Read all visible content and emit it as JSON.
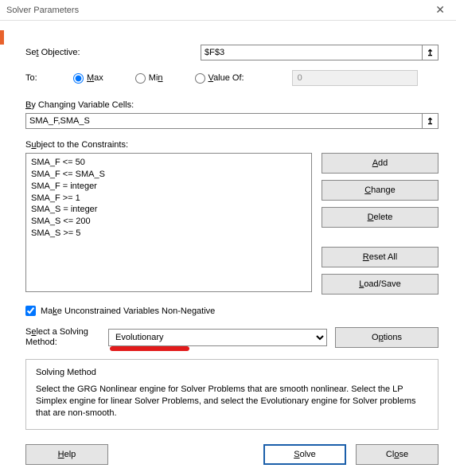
{
  "window": {
    "title": "Solver Parameters"
  },
  "objective": {
    "label_pre": "Se",
    "label_u": "t",
    "label_post": " Objective:",
    "value": "$F$3"
  },
  "to": {
    "label": "To:",
    "max_u": "M",
    "max_post": "ax",
    "min_pre": "Mi",
    "min_u": "n",
    "valueof_u": "V",
    "valueof_post": "alue Of:",
    "valueof_value": "0"
  },
  "cells": {
    "label_u": "B",
    "label_post": "y Changing Variable Cells:",
    "value": "SMA_F,SMA_S"
  },
  "constraints": {
    "label_pre": "S",
    "label_u": "u",
    "label_post": "bject to the Constraints:",
    "items": [
      "SMA_F <= 50",
      "SMA_F <= SMA_S",
      "SMA_F = integer",
      "SMA_F >= 1",
      "SMA_S = integer",
      "SMA_S <= 200",
      "SMA_S >= 5"
    ],
    "buttons": {
      "add_u": "A",
      "add_post": "dd",
      "change_u": "C",
      "change_post": "hange",
      "delete_u": "D",
      "delete_post": "elete",
      "reset_u": "R",
      "reset_post": "eset All",
      "load_u": "L",
      "load_post": "oad/Save"
    }
  },
  "checkbox": {
    "pre": "Ma",
    "u": "k",
    "post": "e Unconstrained Variables Non-Negative",
    "checked": true
  },
  "method": {
    "label_pre": "S",
    "label_u": "e",
    "label_post": "lect a Solving Method:",
    "selected": "Evolutionary",
    "options_pre": "O",
    "options_u": "p",
    "options_post": "tions"
  },
  "info": {
    "title": "Solving Method",
    "body": "Select the GRG Nonlinear engine for Solver Problems that are smooth nonlinear. Select the LP Simplex engine for linear Solver Problems, and select the Evolutionary engine for Solver problems that are non-smooth."
  },
  "footer": {
    "help_u": "H",
    "help_post": "elp",
    "solve_u": "S",
    "solve_post": "olve",
    "close_pre": "Cl",
    "close_u": "o",
    "close_post": "se"
  }
}
